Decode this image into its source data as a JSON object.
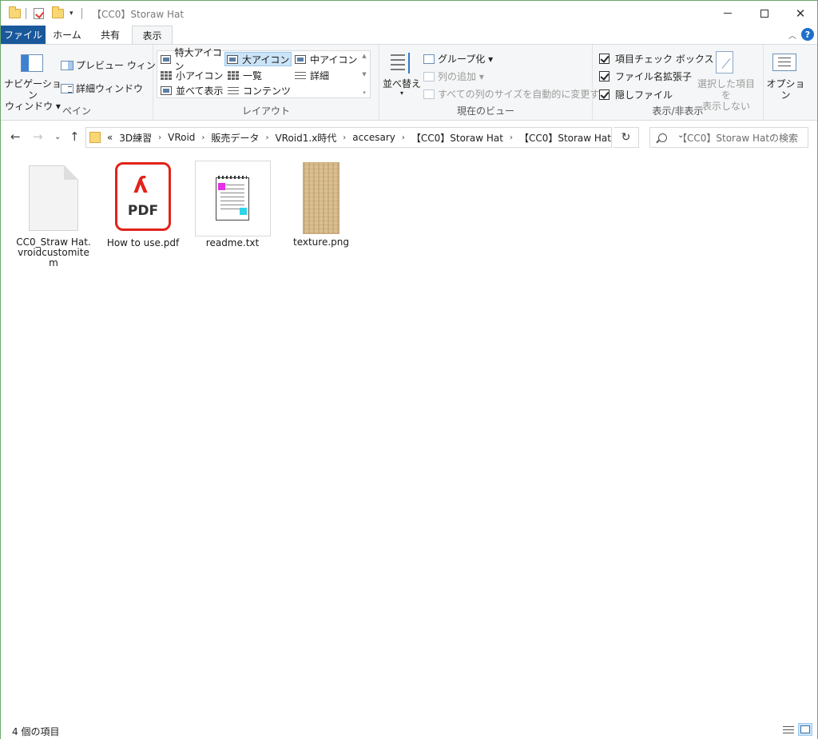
{
  "window": {
    "title": "【CC0】Storaw Hat",
    "minimize": "—",
    "maximize": "☐",
    "close": "✕"
  },
  "ribbon_tabs": [
    "ファイル",
    "ホーム",
    "共有",
    "表示"
  ],
  "ribbon": {
    "pane": {
      "nav_pane": "ナビゲーション",
      "nav_pane_2": "ウィンドウ ▾",
      "preview_pane": "プレビュー ウィンドウ",
      "details_pane": "詳細ウィンドウ",
      "label": "ペイン"
    },
    "layout": {
      "items": [
        "特大アイコン",
        "大アイコン",
        "中アイコン",
        "小アイコン",
        "一覧",
        "詳細",
        "並べて表示",
        "コンテンツ"
      ],
      "selected": "大アイコン",
      "label": "レイアウト"
    },
    "current_view": {
      "sort": "並べ替え",
      "group": "グループ化 ▾",
      "add_column": "列の追加 ▾",
      "fit_columns": "すべての列のサイズを自動的に変更する",
      "label": "現在のビュー"
    },
    "show_hide": {
      "item_checkboxes": "項目チェック ボックス",
      "file_extensions": "ファイル名拡張子",
      "hidden_items": "隠しファイル",
      "hide_selected_1": "選択した項目を",
      "hide_selected_2": "表示しない",
      "label": "表示/非表示",
      "item_checkboxes_checked": true,
      "file_extensions_checked": true,
      "hidden_items_checked": true
    },
    "options": "オプション"
  },
  "address_bar": {
    "breadcrumbs": [
      "3D練習",
      "VRoid",
      "販売データ",
      "VRoid1.x時代",
      "accesary",
      "【CC0】Storaw Hat",
      "【CC0】Storaw Hat"
    ],
    "overflow": "«",
    "search_placeholder": "【CC0】Storaw Hatの検索"
  },
  "files": [
    {
      "name": "CC0_Straw Hat.vroidcustomitem",
      "type": "generic"
    },
    {
      "name": "How to use.pdf",
      "type": "pdf",
      "icon_text": "PDF"
    },
    {
      "name": "readme.txt",
      "type": "txt"
    },
    {
      "name": "texture.png",
      "type": "png"
    }
  ],
  "status": {
    "item_count": "4 個の項目"
  },
  "colors": {
    "file_tab": "#19589b",
    "selection": "#cce4f7",
    "pdf_red": "#e2231a",
    "folder": "#f8d775"
  }
}
